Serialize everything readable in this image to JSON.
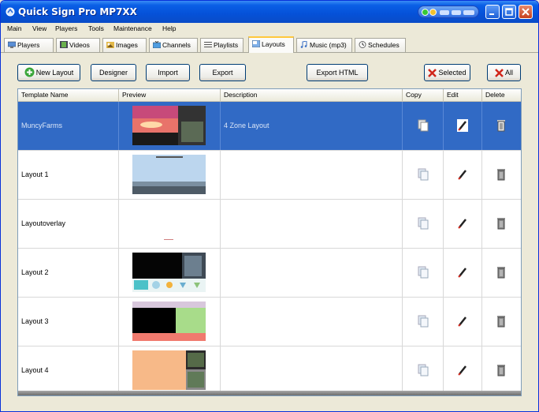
{
  "window": {
    "title": "Quick Sign Pro MP7XX"
  },
  "menu": [
    "Main",
    "View",
    "Players",
    "Tools",
    "Maintenance",
    "Help"
  ],
  "tabs": [
    {
      "label": "Players",
      "icon": "players-icon"
    },
    {
      "label": "Videos",
      "icon": "videos-icon"
    },
    {
      "label": "Images",
      "icon": "images-icon"
    },
    {
      "label": "Channels",
      "icon": "channels-icon"
    },
    {
      "label": "Playlists",
      "icon": "playlists-icon"
    },
    {
      "label": "Layouts",
      "icon": "layouts-icon",
      "active": true
    },
    {
      "label": "Music (mp3)",
      "icon": "music-icon"
    },
    {
      "label": "Schedules",
      "icon": "schedules-icon"
    }
  ],
  "toolbar": {
    "new_layout": "New Layout",
    "designer": "Designer",
    "import": "Import",
    "export": "Export",
    "export_html": "Export HTML",
    "delete_selected": "Selected",
    "delete_all": "All"
  },
  "table": {
    "columns": [
      "Template Name",
      "Preview",
      "Description",
      "Copy",
      "Edit",
      "Delete"
    ],
    "rows": [
      {
        "name": "MuncyFarms",
        "description": "4 Zone Layout",
        "selected": true,
        "preview": "muncy"
      },
      {
        "name": "Layout 1",
        "description": "",
        "preview": "layout1"
      },
      {
        "name": "Layoutoverlay",
        "description": "",
        "preview": "overlay"
      },
      {
        "name": "Layout 2",
        "description": "",
        "preview": "layout2"
      },
      {
        "name": "Layout 3",
        "description": "",
        "preview": "layout3"
      },
      {
        "name": "Layout 4",
        "description": "",
        "preview": "layout4"
      }
    ]
  },
  "colors": {
    "titlebar": "#0551d8",
    "selection": "#316ac5",
    "active_tab_accent": "#ffc83c"
  }
}
